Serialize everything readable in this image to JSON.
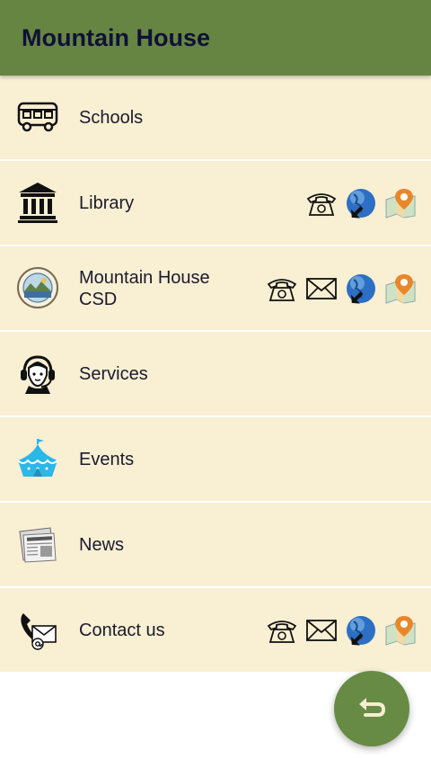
{
  "app_bar": {
    "title": "Mountain House",
    "color": "#668542"
  },
  "menu": {
    "items": [
      {
        "label": "Schools",
        "icon": "school-bus-icon",
        "actions": []
      },
      {
        "label": "Library",
        "icon": "library-building-icon",
        "actions": [
          "phone-icon",
          "web-globe-icon",
          "map-pin-icon"
        ]
      },
      {
        "label": "Mountain House CSD",
        "icon": "csd-seal-icon",
        "actions": [
          "phone-icon",
          "email-icon",
          "web-globe-icon",
          "map-pin-icon"
        ]
      },
      {
        "label": "Services",
        "icon": "headset-agent-icon",
        "actions": []
      },
      {
        "label": "Events",
        "icon": "tent-icon",
        "actions": []
      },
      {
        "label": "News",
        "icon": "newspaper-icon",
        "actions": []
      },
      {
        "label": "Contact us",
        "icon": "contact-phone-mail-icon",
        "actions": [
          "phone-icon",
          "email-icon",
          "web-globe-icon",
          "map-pin-icon"
        ]
      }
    ],
    "row_background": "#f9efd3"
  },
  "fab": {
    "icon": "return-arrow-icon",
    "color": "#678a45"
  }
}
